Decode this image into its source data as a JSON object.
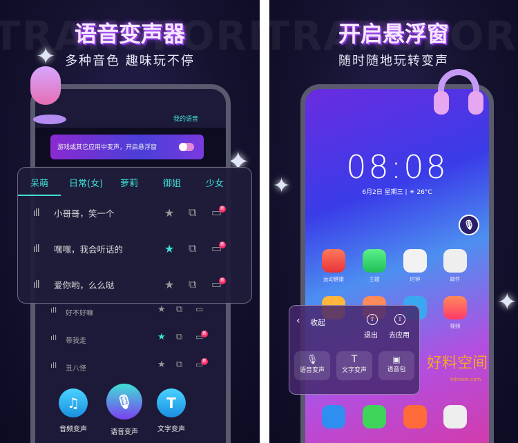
{
  "left": {
    "bg_word": "TRANSFORMER",
    "title": "语音变声器",
    "subtitle": "多种音色 趣味玩不停",
    "my_voice": "我的语音",
    "banner_text": "游戏或其它应用中变声，开启悬浮窗",
    "banner_toggle_on": true,
    "tabs": [
      "呆萌",
      "日常(女)",
      "萝莉",
      "御姐",
      "少女"
    ],
    "active_tab": "呆萌",
    "card_rows": [
      {
        "text": "小哥哥，笑一个",
        "favorite": false,
        "badge": "新"
      },
      {
        "text": "嘿嘿，我会听话的",
        "favorite": true,
        "badge": "新"
      },
      {
        "text": "爱你哟，么么哒",
        "favorite": false,
        "badge": "新"
      }
    ],
    "list_rows": [
      {
        "text": "好不好嘛",
        "favorite": false,
        "badge": "新"
      },
      {
        "text": "带我走",
        "favorite": true,
        "badge": "新"
      },
      {
        "text": "丑八怪",
        "favorite": false,
        "badge": "新"
      }
    ],
    "bottom_buttons": [
      {
        "label": "音频变声",
        "icon": "music-note-icon",
        "glyph": "♫"
      },
      {
        "label": "语音变声",
        "icon": "microphone-icon",
        "glyph": "🎙"
      },
      {
        "label": "文字变声",
        "icon": "text-icon",
        "glyph": "T"
      }
    ]
  },
  "right": {
    "bg_word": "TRANSFORMER",
    "title": "开启悬浮窗",
    "subtitle": "随时随地玩转变声",
    "clock": "08:08",
    "date": "6月2日  星期三  |  ☀ 26°C",
    "apps_row1": [
      "运动健康",
      "主题",
      "时钟",
      "邮件"
    ],
    "apps_row2_visible_label": "视频",
    "float_panel": {
      "collapse": "收起",
      "exit": "退出",
      "go_app": "去应用",
      "buttons": [
        "语音变声",
        "文字变声",
        "语音包"
      ]
    },
    "watermark": "好料空间",
    "watermark_url": "h6room.com"
  },
  "colors": {
    "accent": "#3fe0d6",
    "badge": "#ff2d6a",
    "bg": "#14122e"
  }
}
